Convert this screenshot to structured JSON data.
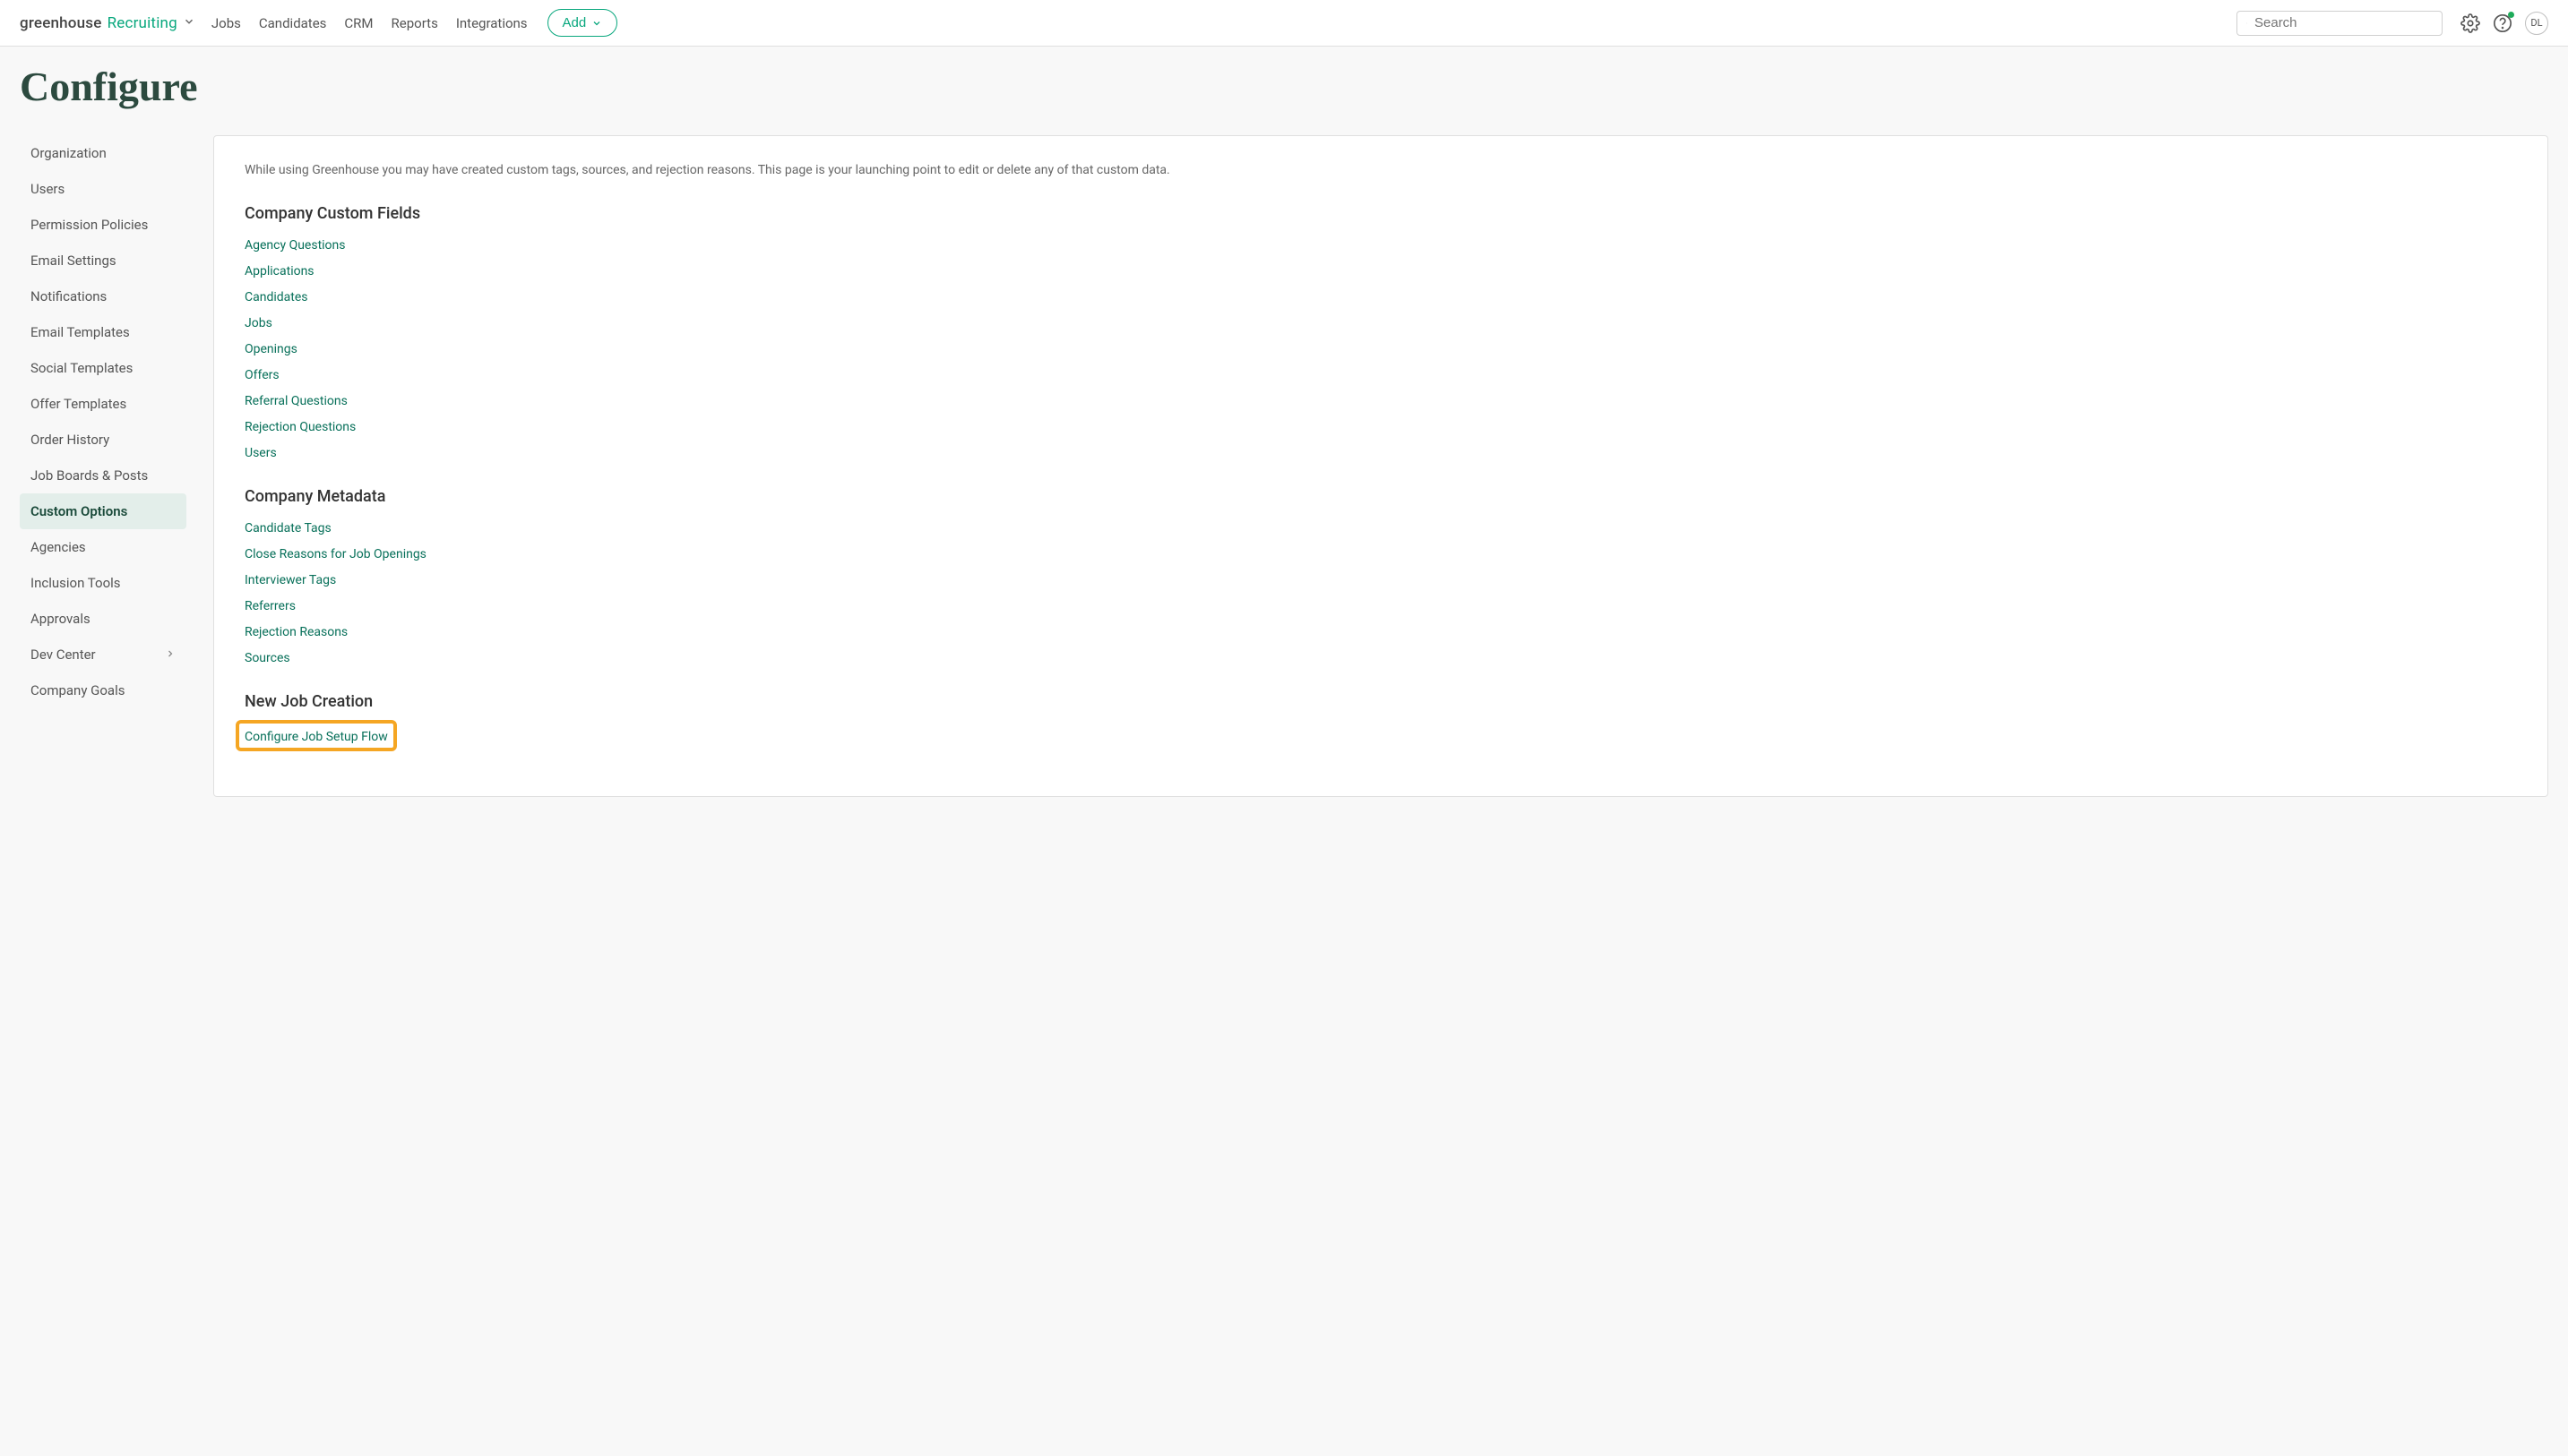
{
  "header": {
    "logo_part1": "greenhouse",
    "logo_part2": "Recruiting",
    "nav": [
      "Jobs",
      "Candidates",
      "CRM",
      "Reports",
      "Integrations"
    ],
    "add_label": "Add",
    "search_placeholder": "Search",
    "avatar_initials": "DL"
  },
  "page_title": "Configure",
  "sidebar": {
    "items": [
      {
        "label": "Organization",
        "active": false
      },
      {
        "label": "Users",
        "active": false
      },
      {
        "label": "Permission Policies",
        "active": false
      },
      {
        "label": "Email Settings",
        "active": false
      },
      {
        "label": "Notifications",
        "active": false
      },
      {
        "label": "Email Templates",
        "active": false
      },
      {
        "label": "Social Templates",
        "active": false
      },
      {
        "label": "Offer Templates",
        "active": false
      },
      {
        "label": "Order History",
        "active": false
      },
      {
        "label": "Job Boards & Posts",
        "active": false
      },
      {
        "label": "Custom Options",
        "active": true
      },
      {
        "label": "Agencies",
        "active": false
      },
      {
        "label": "Inclusion Tools",
        "active": false
      },
      {
        "label": "Approvals",
        "active": false
      },
      {
        "label": "Dev Center",
        "active": false,
        "chevron": true
      },
      {
        "label": "Company Goals",
        "active": false
      }
    ]
  },
  "content": {
    "intro": "While using Greenhouse you may have created custom tags, sources, and rejection reasons. This page is your launching point to edit or delete any of that custom data.",
    "sections": [
      {
        "heading": "Company Custom Fields",
        "links": [
          "Agency Questions",
          "Applications",
          "Candidates",
          "Jobs",
          "Openings",
          "Offers",
          "Referral Questions",
          "Rejection Questions",
          "Users"
        ]
      },
      {
        "heading": "Company Metadata",
        "links": [
          "Candidate Tags",
          "Close Reasons for Job Openings",
          "Interviewer Tags",
          "Referrers",
          "Rejection Reasons",
          "Sources"
        ]
      },
      {
        "heading": "New Job Creation",
        "links": [
          "Configure Job Setup Flow"
        ],
        "highlight_first": true
      }
    ]
  }
}
